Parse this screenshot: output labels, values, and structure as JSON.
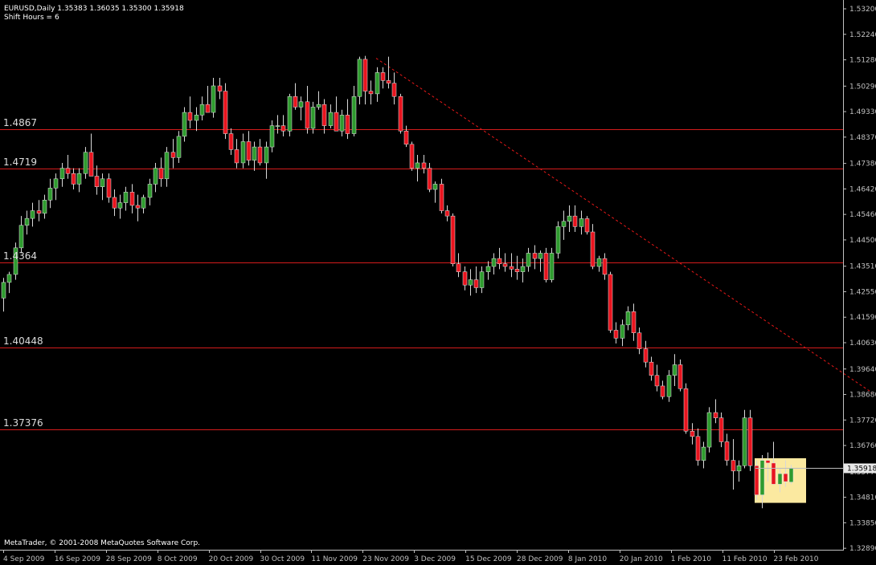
{
  "header": {
    "title": "EURUSD,Daily  1.35383 1.36035 1.35300 1.35918",
    "subtitle": "Shift Hours = 6"
  },
  "footer": {
    "copyright": "MetaTrader, © 2001-2008 MetaQuotes Software Corp."
  },
  "colors": {
    "background": "#000000",
    "axis": "#c0c0c0",
    "up_candle": "#2e9b2e",
    "down_candle": "#e8141e",
    "level_line": "#d41c1c",
    "trend_line": "#e81818",
    "highlight": "#fbe9a0",
    "text": "#ffffff"
  },
  "chart_data": {
    "type": "candlestick",
    "symbol": "EURUSD",
    "timeframe": "Daily",
    "y_range": [
      1.3288,
      1.5323
    ],
    "y_ticks": [
      "1.53200",
      "1.52240",
      "1.51280",
      "1.50290",
      "1.49330",
      "1.48370",
      "1.47380",
      "1.46420",
      "1.45460",
      "1.44500",
      "1.43510",
      "1.42550",
      "1.41590",
      "1.40630",
      "1.39640",
      "1.38680",
      "1.37720",
      "1.36760",
      "1.35770",
      "1.34810",
      "1.33850",
      "1.32890"
    ],
    "current_price": "1.35918",
    "x_labels": [
      "4 Sep 2009",
      "16 Sep 2009",
      "28 Sep 2009",
      "8 Oct 2009",
      "20 Oct 2009",
      "30 Oct 2009",
      "11 Nov 2009",
      "23 Nov 2009",
      "3 Dec 2009",
      "15 Dec 2009",
      "28 Dec 2009",
      "8 Jan 2010",
      "20 Jan 2010",
      "1 Feb 2010",
      "11 Feb 2010",
      "23 Feb 2010"
    ],
    "levels": [
      {
        "label": "1.4867",
        "value": 1.4867
      },
      {
        "label": "1.4719",
        "value": 1.4719
      },
      {
        "label": "1.4364",
        "value": 1.4364
      },
      {
        "label": "1.40448",
        "value": 1.40448
      },
      {
        "label": "1.37376",
        "value": 1.37376
      }
    ],
    "trendline": [
      [
        468,
        1.5134
      ],
      [
        1085,
        1.3875
      ]
    ],
    "highlight_price_range": [
      1.3628,
      1.346
    ],
    "candles": [
      [
        1.4231,
        1.4307,
        1.418,
        1.429
      ],
      [
        1.429,
        1.433,
        1.425,
        1.432
      ],
      [
        1.432,
        1.444,
        1.43,
        1.442
      ],
      [
        1.442,
        1.454,
        1.44,
        1.4505
      ],
      [
        1.4505,
        1.456,
        1.447,
        1.4531
      ],
      [
        1.4531,
        1.459,
        1.45,
        1.456
      ],
      [
        1.456,
        1.46,
        1.452,
        1.455
      ],
      [
        1.455,
        1.462,
        1.453,
        1.46
      ],
      [
        1.46,
        1.468,
        1.457,
        1.4645
      ],
      [
        1.4645,
        1.47,
        1.46,
        1.468
      ],
      [
        1.468,
        1.474,
        1.465,
        1.472
      ],
      [
        1.472,
        1.477,
        1.468,
        1.47
      ],
      [
        1.47,
        1.472,
        1.464,
        1.466
      ],
      [
        1.466,
        1.472,
        1.463,
        1.47
      ],
      [
        1.47,
        1.48,
        1.468,
        1.478
      ],
      [
        1.478,
        1.485,
        1.475,
        1.469
      ],
      [
        1.469,
        1.473,
        1.462,
        1.465
      ],
      [
        1.465,
        1.47,
        1.46,
        1.468
      ],
      [
        1.468,
        1.47,
        1.459,
        1.461
      ],
      [
        1.461,
        1.464,
        1.454,
        1.457
      ],
      [
        1.457,
        1.462,
        1.453,
        1.459
      ],
      [
        1.459,
        1.465,
        1.456,
        1.463
      ],
      [
        1.463,
        1.466,
        1.455,
        1.458
      ],
      [
        1.458,
        1.462,
        1.452,
        1.457
      ],
      [
        1.457,
        1.462,
        1.455,
        1.461
      ],
      [
        1.461,
        1.468,
        1.458,
        1.466
      ],
      [
        1.466,
        1.474,
        1.463,
        1.472
      ],
      [
        1.472,
        1.476,
        1.465,
        1.468
      ],
      [
        1.468,
        1.48,
        1.465,
        1.478
      ],
      [
        1.478,
        1.483,
        1.472,
        1.476
      ],
      [
        1.476,
        1.486,
        1.474,
        1.484
      ],
      [
        1.484,
        1.495,
        1.482,
        1.493
      ],
      [
        1.493,
        1.499,
        1.487,
        1.49
      ],
      [
        1.49,
        1.495,
        1.486,
        1.492
      ],
      [
        1.492,
        1.499,
        1.49,
        1.496
      ],
      [
        1.496,
        1.503,
        1.493,
        1.493
      ],
      [
        1.493,
        1.506,
        1.491,
        1.503
      ],
      [
        1.503,
        1.506,
        1.498,
        1.501
      ],
      [
        1.501,
        1.504,
        1.483,
        1.485
      ],
      [
        1.485,
        1.487,
        1.477,
        1.479
      ],
      [
        1.479,
        1.483,
        1.472,
        1.474
      ],
      [
        1.474,
        1.485,
        1.472,
        1.482
      ],
      [
        1.482,
        1.486,
        1.473,
        1.475
      ],
      [
        1.475,
        1.482,
        1.471,
        1.48
      ],
      [
        1.48,
        1.483,
        1.473,
        1.474
      ],
      [
        1.474,
        1.482,
        1.468,
        1.48
      ],
      [
        1.48,
        1.49,
        1.478,
        1.488
      ],
      [
        1.488,
        1.492,
        1.485,
        1.488
      ],
      [
        1.488,
        1.492,
        1.484,
        1.486
      ],
      [
        1.486,
        1.5,
        1.484,
        1.499
      ],
      [
        1.499,
        1.504,
        1.494,
        1.495
      ],
      [
        1.495,
        1.499,
        1.49,
        1.497
      ],
      [
        1.497,
        1.503,
        1.485,
        1.487
      ],
      [
        1.487,
        1.497,
        1.485,
        1.495
      ],
      [
        1.495,
        1.501,
        1.494,
        1.496
      ],
      [
        1.496,
        1.498,
        1.485,
        1.488
      ],
      [
        1.488,
        1.496,
        1.487,
        1.493
      ],
      [
        1.493,
        1.499,
        1.488,
        1.486
      ],
      [
        1.486,
        1.494,
        1.484,
        1.492
      ],
      [
        1.492,
        1.498,
        1.483,
        1.485
      ],
      [
        1.485,
        1.503,
        1.484,
        1.499
      ],
      [
        1.499,
        1.514,
        1.496,
        1.513
      ],
      [
        1.513,
        1.5143,
        1.496,
        1.501
      ],
      [
        1.501,
        1.505,
        1.496,
        1.5
      ],
      [
        1.5,
        1.51,
        1.497,
        1.508
      ],
      [
        1.508,
        1.51,
        1.502,
        1.505
      ],
      [
        1.505,
        1.514,
        1.502,
        1.504
      ],
      [
        1.504,
        1.508,
        1.496,
        1.499
      ],
      [
        1.499,
        1.5,
        1.485,
        1.486
      ],
      [
        1.486,
        1.488,
        1.48,
        1.481
      ],
      [
        1.481,
        1.482,
        1.471,
        1.472
      ],
      [
        1.472,
        1.477,
        1.467,
        1.474
      ],
      [
        1.474,
        1.477,
        1.47,
        1.472
      ],
      [
        1.472,
        1.474,
        1.463,
        1.464
      ],
      [
        1.464,
        1.467,
        1.459,
        1.466
      ],
      [
        1.466,
        1.468,
        1.455,
        1.456
      ],
      [
        1.456,
        1.458,
        1.452,
        1.454
      ],
      [
        1.454,
        1.455,
        1.435,
        1.436
      ],
      [
        1.436,
        1.44,
        1.431,
        1.433
      ],
      [
        1.433,
        1.435,
        1.426,
        1.428
      ],
      [
        1.428,
        1.434,
        1.424,
        1.43
      ],
      [
        1.43,
        1.435,
        1.425,
        1.427
      ],
      [
        1.427,
        1.435,
        1.425,
        1.433
      ],
      [
        1.433,
        1.437,
        1.43,
        1.435
      ],
      [
        1.435,
        1.44,
        1.432,
        1.438
      ],
      [
        1.438,
        1.442,
        1.434,
        1.436
      ],
      [
        1.436,
        1.44,
        1.433,
        1.435
      ],
      [
        1.435,
        1.44,
        1.431,
        1.434
      ],
      [
        1.434,
        1.439,
        1.43,
        1.433
      ],
      [
        1.433,
        1.438,
        1.429,
        1.435
      ],
      [
        1.435,
        1.442,
        1.433,
        1.44
      ],
      [
        1.44,
        1.443,
        1.434,
        1.438
      ],
      [
        1.438,
        1.441,
        1.433,
        1.44
      ],
      [
        1.44,
        1.442,
        1.429,
        1.43
      ],
      [
        1.43,
        1.442,
        1.429,
        1.44
      ],
      [
        1.44,
        1.452,
        1.438,
        1.45
      ],
      [
        1.45,
        1.456,
        1.445,
        1.452
      ],
      [
        1.452,
        1.458,
        1.448,
        1.454
      ],
      [
        1.454,
        1.458,
        1.448,
        1.45
      ],
      [
        1.45,
        1.456,
        1.447,
        1.453
      ],
      [
        1.453,
        1.454,
        1.447,
        1.448
      ],
      [
        1.448,
        1.451,
        1.434,
        1.435
      ],
      [
        1.435,
        1.439,
        1.433,
        1.438
      ],
      [
        1.438,
        1.44,
        1.43,
        1.432
      ],
      [
        1.432,
        1.433,
        1.41,
        1.411
      ],
      [
        1.411,
        1.414,
        1.406,
        1.408
      ],
      [
        1.408,
        1.415,
        1.405,
        1.413
      ],
      [
        1.413,
        1.42,
        1.411,
        1.418
      ],
      [
        1.418,
        1.421,
        1.407,
        1.41
      ],
      [
        1.41,
        1.412,
        1.402,
        1.404
      ],
      [
        1.404,
        1.407,
        1.397,
        1.399
      ],
      [
        1.399,
        1.401,
        1.392,
        1.394
      ],
      [
        1.394,
        1.398,
        1.388,
        1.39
      ],
      [
        1.39,
        1.392,
        1.385,
        1.386
      ],
      [
        1.386,
        1.396,
        1.384,
        1.394
      ],
      [
        1.394,
        1.402,
        1.39,
        1.398
      ],
      [
        1.398,
        1.4,
        1.388,
        1.389
      ],
      [
        1.389,
        1.391,
        1.372,
        1.373
      ],
      [
        1.373,
        1.376,
        1.368,
        1.371
      ],
      [
        1.371,
        1.374,
        1.36,
        1.362
      ],
      [
        1.362,
        1.369,
        1.359,
        1.367
      ],
      [
        1.367,
        1.382,
        1.365,
        1.38
      ],
      [
        1.38,
        1.385,
        1.376,
        1.378
      ],
      [
        1.378,
        1.38,
        1.367,
        1.369
      ],
      [
        1.369,
        1.372,
        1.36,
        1.362
      ],
      [
        1.362,
        1.37,
        1.351,
        1.358
      ],
      [
        1.358,
        1.362,
        1.354,
        1.36
      ],
      [
        1.36,
        1.381,
        1.359,
        1.378
      ],
      [
        1.378,
        1.381,
        1.358,
        1.36
      ],
      [
        1.36,
        1.362,
        1.347,
        1.349
      ],
      [
        1.349,
        1.364,
        1.344,
        1.362
      ],
      [
        1.362,
        1.365,
        1.354,
        1.361
      ],
      [
        1.361,
        1.369,
        1.353,
        1.353
      ],
      [
        1.353,
        1.359,
        1.35,
        1.357
      ],
      [
        1.357,
        1.362,
        1.352,
        1.354
      ],
      [
        1.3538,
        1.3603,
        1.353,
        1.3592
      ]
    ]
  }
}
